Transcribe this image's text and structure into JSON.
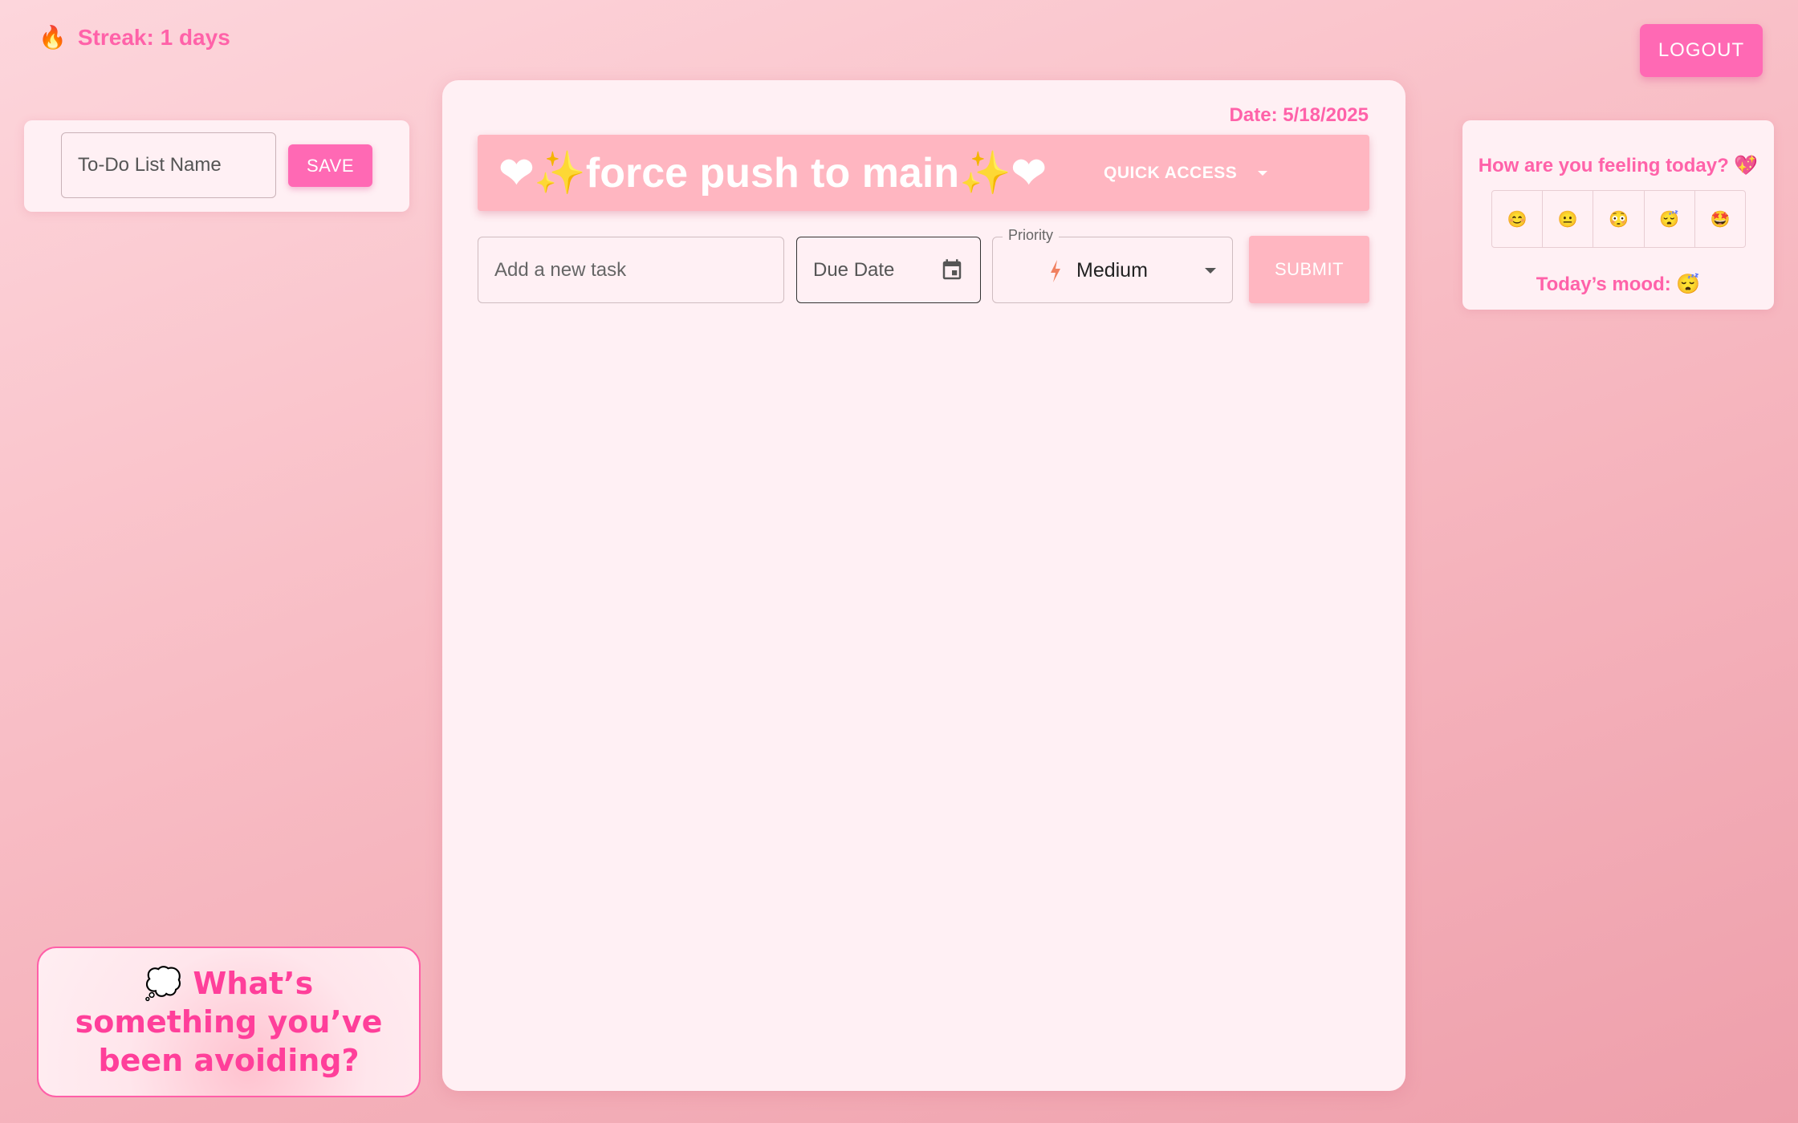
{
  "header": {
    "streak_icon": "🔥",
    "streak_text": "Streak: 1 days",
    "logout_label": "LOGOUT"
  },
  "list_name": {
    "placeholder": "To-Do List Name",
    "save_label": "SAVE"
  },
  "main": {
    "date_text": "Date: 5/18/2025",
    "title": "❤✨force push to main✨❤",
    "quick_access_label": "QUICK ACCESS",
    "task_placeholder": "Add a new task",
    "due_date_placeholder": "Due Date",
    "priority_label": "Priority",
    "priority_value": "Medium",
    "submit_label": "SUBMIT"
  },
  "mood": {
    "question": "How are you feeling today? 💖",
    "options": [
      "😊",
      "😐",
      "😳",
      "😴",
      "🤩"
    ],
    "today_label": "Today’s mood: 😴"
  },
  "prompt": {
    "text": "💭 What’s something you’ve been avoiding?"
  },
  "colors": {
    "accent": "#ff69b4",
    "title_bar": "#ffb6c1",
    "card_bg": "#fff0f4"
  }
}
